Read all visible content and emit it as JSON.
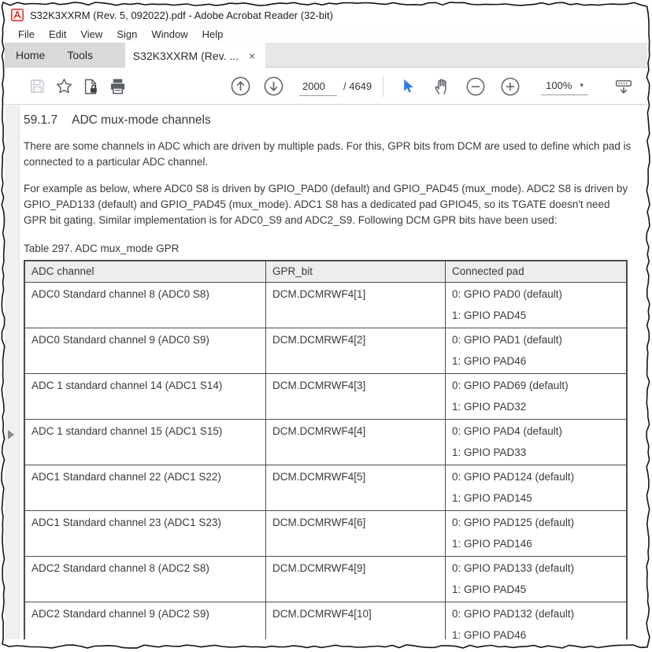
{
  "window": {
    "title": "S32K3XXRM (Rev. 5, 092022).pdf - Adobe Acrobat Reader (32-bit)"
  },
  "menu": {
    "items": [
      "File",
      "Edit",
      "View",
      "Sign",
      "Window",
      "Help"
    ]
  },
  "tabs": {
    "home_label": "Home",
    "tools_label": "Tools",
    "document_label": "S32K3XXRM (Rev. ...",
    "close_glyph": "×"
  },
  "toolbar": {
    "page_number": "2000",
    "page_total": "/ 4649",
    "zoom_level": "100%",
    "zoom_caret_glyph": "▾"
  },
  "content": {
    "heading_number": "59.1.7",
    "heading_title": "ADC mux-mode channels",
    "para1": "There are some channels in ADC which are driven by multiple pads. For this, GPR bits from DCM are used to define which pad is connected to a particular ADC channel.",
    "para2": "For example as below, where ADC0 S8 is driven by GPIO_PAD0 (default) and GPIO_PAD45 (mux_mode). ADC2 S8 is driven by GPIO_PAD133 (default) and GPIO_PAD45 (mux_mode). ADC1 S8 has a dedicated pad GPIO45, so its TGATE doesn't need GPR bit gating. Similar implementation is for ADC0_S9 and ADC2_S9. Following DCM GPR bits have been used:",
    "table_caption": "Table 297.  ADC mux_mode GPR",
    "table": {
      "headers": [
        "ADC channel",
        "GPR_bit",
        "Connected pad"
      ],
      "rows": [
        [
          "ADC0 Standard channel 8 (ADC0 S8)",
          "DCM.DCMRWF4[1]",
          "0: GPIO PAD0 (default)",
          "1: GPIO PAD45"
        ],
        [
          "ADC0 Standard channel 9 (ADC0 S9)",
          "DCM.DCMRWF4[2]",
          "0: GPIO PAD1 (default)",
          "1: GPIO PAD46"
        ],
        [
          "ADC 1 standard channel 14 (ADC1 S14)",
          "DCM.DCMRWF4[3]",
          "0: GPIO PAD69 (default)",
          "1: GPIO PAD32"
        ],
        [
          "ADC 1 standard channel 15 (ADC1 S15)",
          "DCM.DCMRWF4[4]",
          "0: GPIO PAD4 (default)",
          "1: GPIO PAD33"
        ],
        [
          "ADC1 Standard channel 22 (ADC1 S22)",
          "DCM.DCMRWF4[5]",
          "0: GPIO PAD124 (default)",
          "1: GPIO PAD145"
        ],
        [
          "ADC1 Standard channel 23 (ADC1 S23)",
          "DCM.DCMRWF4[6]",
          "0: GPIO PAD125 (default)",
          "1: GPIO PAD146"
        ],
        [
          "ADC2 Standard channel 8 (ADC2 S8)",
          "DCM.DCMRWF4[9]",
          "0: GPIO PAD133 (default)",
          "1: GPIO PAD45"
        ],
        [
          "ADC2 Standard channel 9 (ADC2 S9)",
          "DCM.DCMRWF4[10]",
          "0: GPIO PAD132 (default)",
          "1: GPIO PAD46"
        ]
      ]
    }
  },
  "colors": {
    "acrobat_red": "#e2231a",
    "pointer_blue": "#2b7de9",
    "table_border": "#4c4c4c",
    "header_row_bg": "#ededed",
    "tab_gray": "#d9d9d9"
  }
}
